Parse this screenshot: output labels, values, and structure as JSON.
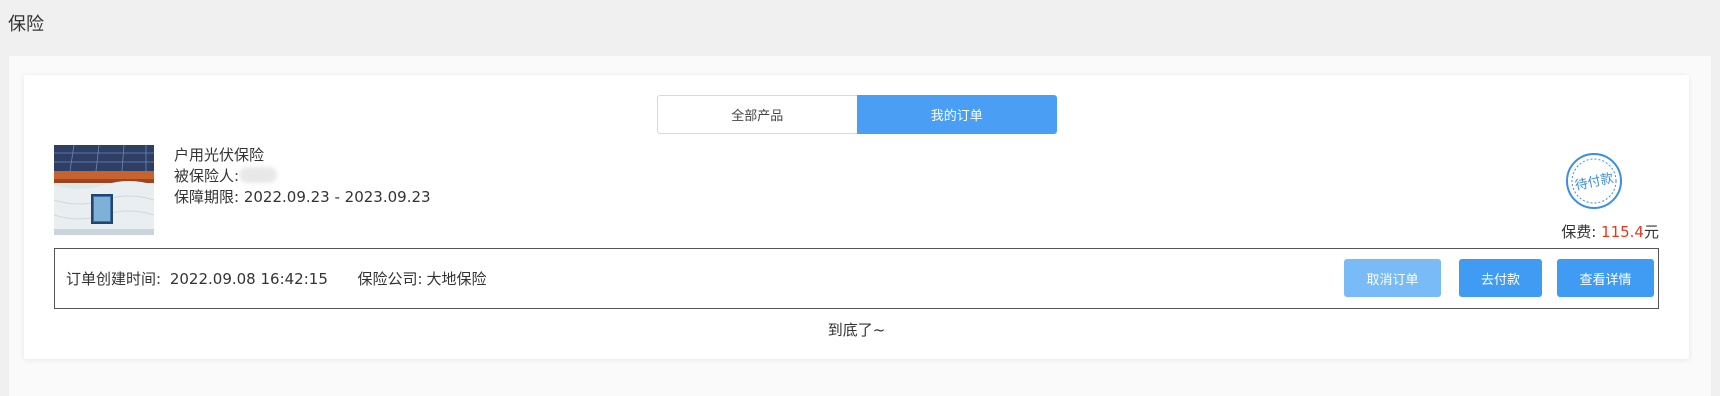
{
  "page": {
    "title": "保险"
  },
  "tabs": [
    {
      "label": "全部产品",
      "active": false
    },
    {
      "label": "我的订单",
      "active": true
    }
  ],
  "order": {
    "product_name": "户用光伏保险",
    "insured_label": "被保险人:",
    "period_label": "保障期限:",
    "period_value": "2022.09.23 - 2023.09.23",
    "status_stamp": "待付款",
    "fee_label": "保费:",
    "fee_amount": "115.4",
    "fee_unit": "元",
    "created_label": "订单创建时间:",
    "created_value": "2022.09.08 16:42:15",
    "company_label": "保险公司:",
    "company_value": "大地保险"
  },
  "actions": {
    "cancel": "取消订单",
    "pay": "去付款",
    "detail": "查看详情"
  },
  "footer": {
    "end_text": "到底了~"
  },
  "colors": {
    "accent": "#4a9ff5",
    "price": "#e8381e",
    "stamp": "#3a8fe0"
  }
}
